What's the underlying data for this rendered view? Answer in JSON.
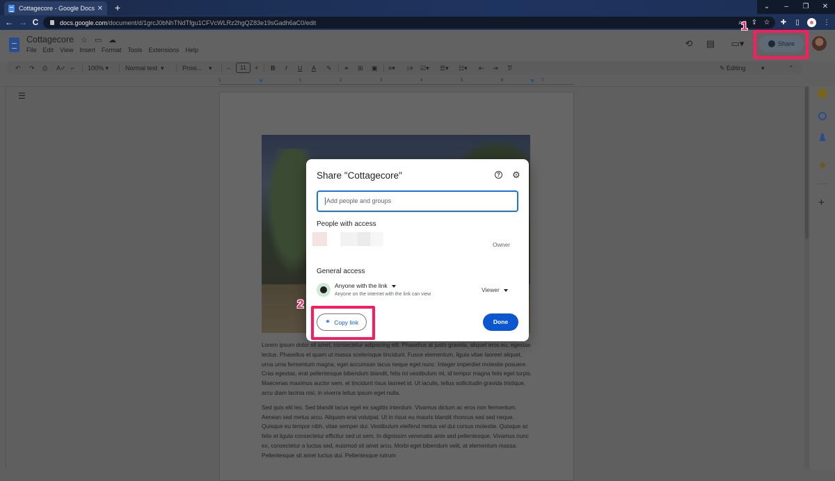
{
  "browser": {
    "tab_title": "Cottagecore - Google Docs",
    "tab_close": "✕",
    "new_tab": "+",
    "url_host": "docs.google.com",
    "url_path": "/document/d/1grcJ0bNhTNdTfgu1CFVcWLRz2hgQZ83e19sGadh6aC0/edit",
    "window_controls": [
      "⌄",
      "–",
      "❐",
      "✕"
    ],
    "nav": {
      "back": "←",
      "forward": "→",
      "reload": "C"
    }
  },
  "docs": {
    "title": "Cottagecore",
    "menu": [
      "File",
      "Edit",
      "View",
      "Insert",
      "Format",
      "Tools",
      "Extensions",
      "Help"
    ],
    "share_label": "Share",
    "toolbar": {
      "zoom": "100%",
      "style": "Normal text",
      "font": "Proxi...",
      "font_size": "11",
      "mode": "Editing"
    },
    "ruler_numbers": [
      "1",
      "1",
      "2",
      "3",
      "4",
      "5",
      "6",
      "7"
    ],
    "body": [
      "Lorem ipsum dolor sit amet, consectetur adipiscing elit. Phasellus at justo gravida, aliquet eros eu, egestas lectus. Phasellus et quam ut massa scelerisque tincidunt. Fusce elementum, ligula vitae laoreet aliquet, urna urna fermentum magna, eget accumsan lacus neque eget nunc. Integer imperdiet molestie posuere. Cras egestas, erat pellentesque bibendum blandit, felis mi vestibulum mi, id tempor magna felis eget turpis. Maecenas maximus auctor sem, et tincidunt risus laoreet id. Ut iaculis, tellus sollicitudin gravida tristique, arcu diam lacinia nisi, in viverra tellus ipsum eget nulla.",
      "Sed quis elit leo. Sed blandit lacus eget ex sagittis interdum. Vivamus dictum ac eros non fermentum. Aenean sed metus arcu. Aliquam erat volutpat. Ut in risus eu mauris blandit rhoncus sed sed neque. Quisque eu tempor nibh, vitae semper dui. Vestibulum eleifend metus vel dui cursus molestie. Quisque ac felis et ligula consectetur efficitur sed ut sem. In dignissim venenatis ante sed pellentesque. Vivamus nunc ex, consectetur a luctus sed, euismod sit amet arcu. Morbi eget bibendum velit, at elementum massa. Pellentesque sit amet luctus dui. Pellentesque rutrum"
    ]
  },
  "dialog": {
    "title": "Share \"Cottagecore\"",
    "help": "?",
    "settings": "⚙",
    "input_placeholder": "Add people and groups",
    "people_label": "People with access",
    "owner_role": "Owner",
    "general_access_label": "General access",
    "access_level": "Anyone with the link",
    "access_desc": "Anyone on the internet with the link can view",
    "role": "Viewer",
    "copy_link": "Copy link",
    "done": "Done"
  },
  "annotations": {
    "step1": "1",
    "step2": "2",
    "color": "#ff1a5e"
  }
}
